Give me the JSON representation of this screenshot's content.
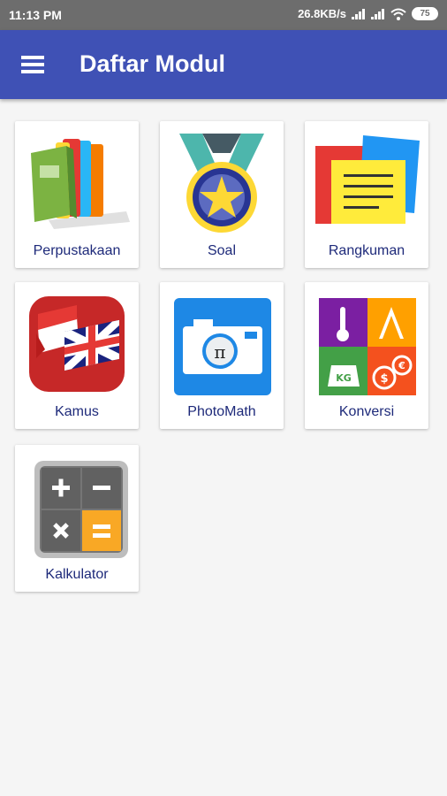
{
  "status": {
    "time": "11:13 PM",
    "speed": "26.8KB/s",
    "battery": "75"
  },
  "app_bar": {
    "title": "Daftar Modul"
  },
  "modules": [
    {
      "label": "Perpustakaan",
      "icon": "books-icon"
    },
    {
      "label": "Soal",
      "icon": "medal-icon"
    },
    {
      "label": "Rangkuman",
      "icon": "notes-icon"
    },
    {
      "label": "Kamus",
      "icon": "flags-icon"
    },
    {
      "label": "PhotoMath",
      "icon": "camera-icon"
    },
    {
      "label": "Konversi",
      "icon": "conversion-icon"
    },
    {
      "label": "Kalkulator",
      "icon": "calculator-icon"
    }
  ],
  "colors": {
    "app_bar": "#3f51b5",
    "status_bar": "#6d6d6d",
    "label": "#1e2a7a"
  }
}
